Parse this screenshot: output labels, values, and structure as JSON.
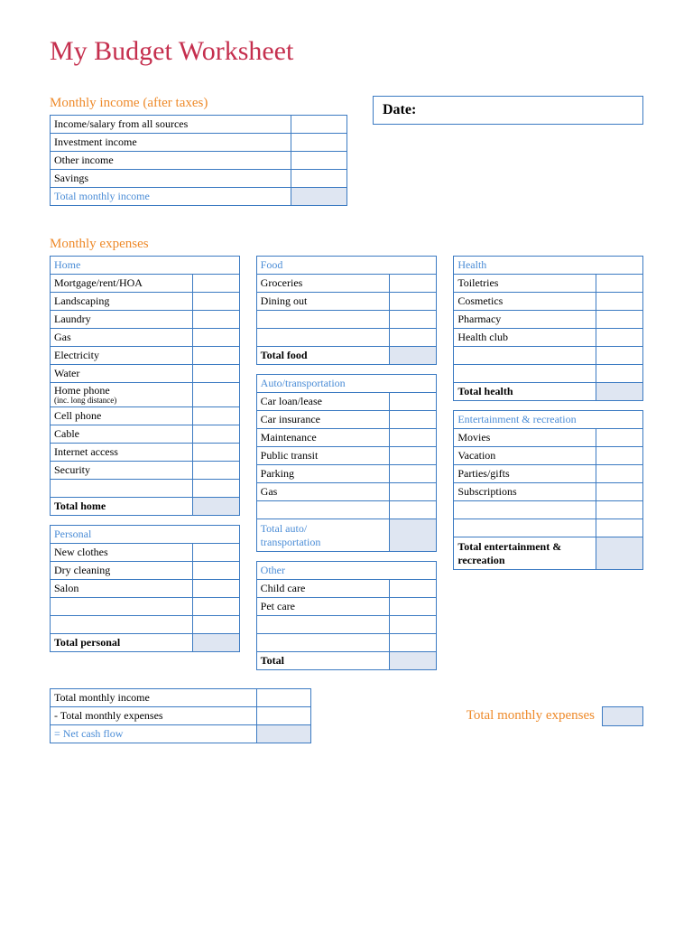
{
  "title": "My Budget Worksheet",
  "incomeSection": {
    "heading": "Monthly income (after taxes)",
    "rows": [
      "Income/salary from all sources",
      "Investment income",
      "Other income",
      "Savings"
    ],
    "totalLabel": "Total monthly income"
  },
  "dateLabel": "Date:",
  "expensesHeading": "Monthly expenses",
  "home": {
    "header": "Home",
    "rows": [
      "Mortgage/rent/HOA",
      "Landscaping",
      "Laundry",
      "Gas",
      "Electricity",
      "Water"
    ],
    "phone": "Home phone",
    "phoneSub": "(inc. long distance)",
    "rows2": [
      "Cell phone",
      "Cable",
      "Internet access",
      "Security"
    ],
    "totalLabel": "Total home"
  },
  "personal": {
    "header": "Personal",
    "rows": [
      "New clothes",
      "Dry cleaning",
      "Salon"
    ],
    "totalLabel": "Total personal"
  },
  "food": {
    "header": "Food",
    "rows": [
      "Groceries",
      "Dining out"
    ],
    "totalLabel": "Total food"
  },
  "auto": {
    "header": "Auto/transportation",
    "rows": [
      "Car loan/lease",
      "Car insurance",
      "Maintenance",
      "Public transit",
      "Parking",
      "Gas"
    ],
    "totalLabel": "Total auto/\ntransportation"
  },
  "other": {
    "header": "Other",
    "rows": [
      "Child care",
      "Pet care"
    ],
    "totalLabel": "Total"
  },
  "health": {
    "header": "Health",
    "rows": [
      "Toiletries",
      "Cosmetics",
      "Pharmacy",
      "Health club"
    ],
    "totalLabel": "Total health"
  },
  "ent": {
    "header": "Entertainment & recreation",
    "rows": [
      "Movies",
      "Vacation",
      "Parties/gifts",
      "Subscriptions"
    ],
    "totalLabel": "Total entertainment & recreation"
  },
  "summary": {
    "rows": [
      "Total monthly income",
      "- Total monthly expenses"
    ],
    "net": "= Net cash flow"
  },
  "totalExpensesLabel": "Total monthly expenses"
}
